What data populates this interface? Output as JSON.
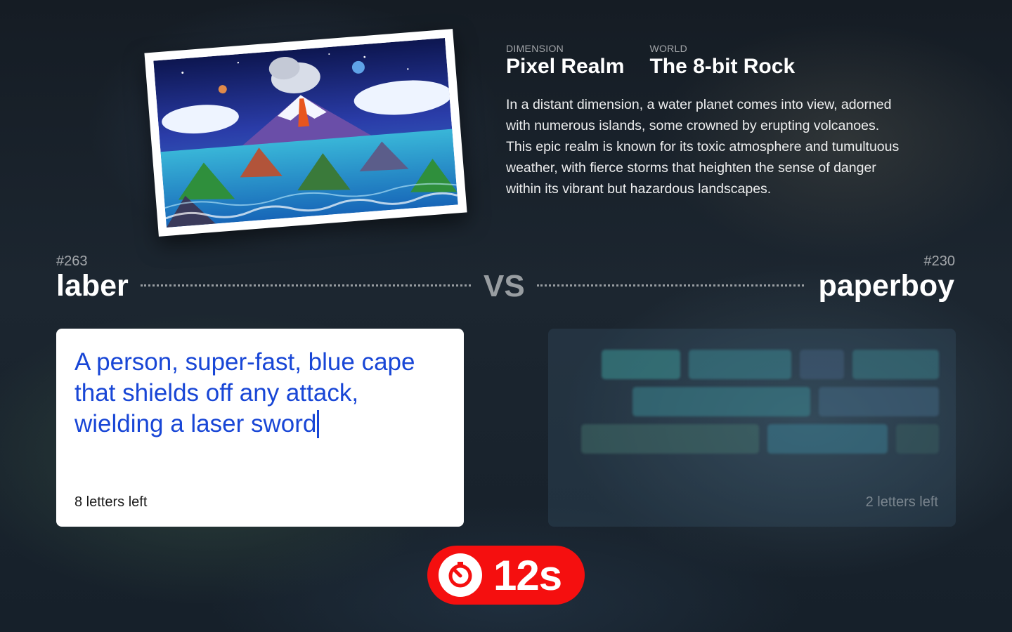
{
  "world_card": {
    "dimension_label": "DIMENSION",
    "dimension_value": "Pixel Realm",
    "world_label": "WORLD",
    "world_value": "The 8-bit Rock",
    "description": "In a distant dimension, a water planet comes into view, adorned with numerous islands, some crowned by erupting volcanoes. This epic realm is known for its toxic atmosphere and tumultuous weather, with fierce storms that heighten the sense of danger within its vibrant but hazardous landscapes."
  },
  "versus": {
    "label": "VS",
    "left_player": {
      "number": "#263",
      "name": "laber"
    },
    "right_player": {
      "number": "#230",
      "name": "paperboy"
    }
  },
  "my_answer": {
    "text": "A person, super-fast, blue cape that shields off any attack, wielding a laser sword",
    "letters_left": "8 letters left"
  },
  "opponent_answer": {
    "letters_left": "2 letters left"
  },
  "timer": {
    "value": "12s",
    "icon": "stopwatch-icon"
  },
  "colors": {
    "answer_text": "#1846d6",
    "timer_bg": "#f50f0f"
  }
}
